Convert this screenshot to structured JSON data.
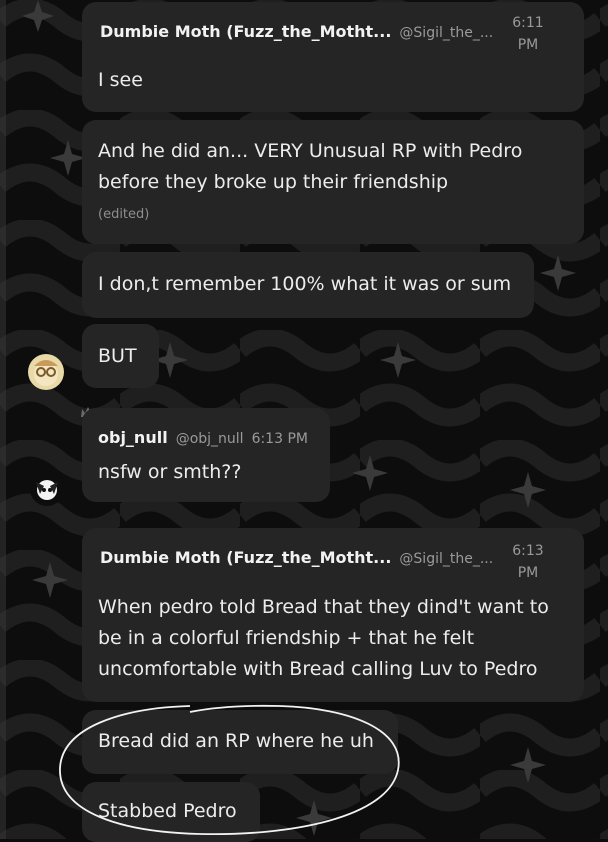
{
  "colors": {
    "background": "#0d0d0d",
    "bubble": "#252526",
    "text": "#ececec",
    "muted": "#9a9a9a"
  },
  "messages": [
    {
      "author": "Dumbie Moth (Fuzz_the_Motht...",
      "handle": "@Sigil_the_...",
      "time_line1": "6:11",
      "time_line2": "PM",
      "text": "I see"
    },
    {
      "text_line1": "And he did an... VERY Unusual RP with Pedro",
      "text_line2": "before they broke up their friendship",
      "edited": "(edited)"
    },
    {
      "text": "I don,t remember 100% what it was or sum"
    },
    {
      "text": "BUT"
    },
    {
      "author": "obj_null",
      "handle": "@obj_null",
      "time": "6:13 PM",
      "text": "nsfw or smth??"
    },
    {
      "author": "Dumbie Moth (Fuzz_the_Motht...",
      "handle": "@Sigil_the_...",
      "time_line1": "6:13",
      "time_line2": "PM",
      "text_line1": "When pedro told Bread that they dind't want to",
      "text_line2": "be in a colorful friendship + that he felt",
      "text_line3": "uncomfortable with Bread calling Luv to Pedro"
    },
    {
      "text": "Bread did an RP where he uh"
    },
    {
      "text": "Stabbed Pedro"
    }
  ],
  "icons": {
    "sparkle": "sparkle-icon",
    "crown": "crown-icon"
  }
}
